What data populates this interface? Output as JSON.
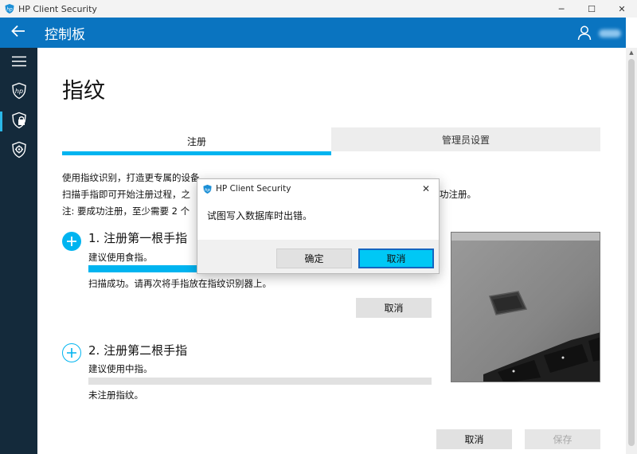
{
  "window": {
    "title": "HP Client Security",
    "minimize_glyph": "─",
    "maximize_glyph": "☐",
    "close_glyph": "✕"
  },
  "appbar": {
    "title": "控制板",
    "back_icon": "arrow-left-icon",
    "user_icon": "person-icon",
    "color": "#0a74c0"
  },
  "sidebar": {
    "items": [
      {
        "icon": "hamburger-menu-icon"
      },
      {
        "icon": "hp-shield-icon"
      },
      {
        "icon": "shield-lock-icon",
        "active": true
      },
      {
        "icon": "shield-gear-icon"
      }
    ],
    "color": "#142a3b",
    "accent": "#2bb8e8"
  },
  "page": {
    "heading": "指纹",
    "tabs": [
      {
        "label": "注册",
        "selected": true
      },
      {
        "label": "管理员设置",
        "selected": false
      }
    ],
    "intro": {
      "line1_left": "使用指纹识别，打造更专属的设备",
      "line2_left": "扫描手指即可开始注册过程，之",
      "line2_right": "功注册。",
      "line3_left": "注:  要成功注册，至少需要 2 个"
    },
    "fingers": [
      {
        "title": "1. 注册第一根手指",
        "hint": "建议使用食指。",
        "progress": 0.4,
        "status": "扫描成功。请再次将手指放在指纹识别器上。",
        "cancel_label": "取消"
      },
      {
        "title": "2. 注册第二根手指",
        "hint": "建议使用中指。",
        "progress": 0,
        "status": "未注册指纹。"
      }
    ],
    "footer": {
      "cancel_label": "取消",
      "save_label": "保存"
    },
    "accent": "#00b4f0"
  },
  "dialog": {
    "title": "HP Client Security",
    "message": "试图写入数据库时出错。",
    "ok_label": "确定",
    "cancel_label": "取消",
    "close_glyph": "✕"
  }
}
